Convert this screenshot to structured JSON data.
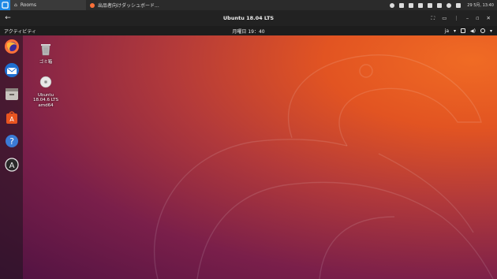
{
  "host": {
    "start_icon": "vmware-icon",
    "tabs": [
      {
        "label": "Rooms",
        "icon": "home-icon",
        "active": true
      },
      {
        "label": "出品者向けダッシュボード...",
        "icon": "firefox-icon",
        "active": false
      }
    ],
    "tray_icons": [
      "settings-icon",
      "bell-icon",
      "bluetooth-icon",
      "battery-icon",
      "volume-icon",
      "network-icon",
      "cloud-icon",
      "clipboard-icon"
    ],
    "clock": "29 5月, 13:40"
  },
  "vm": {
    "title": "Ubuntu 18.04 LTS",
    "controls": [
      "fullscreen-icon",
      "console-icon",
      "more-icon",
      "minimize-icon",
      "maximize-icon",
      "close-icon"
    ]
  },
  "panel": {
    "activities": "アクティビティ",
    "clock": "月曜日 19：40",
    "status": {
      "language": "ja"
    }
  },
  "dock": {
    "apps": [
      "firefox-icon",
      "thunderbird-icon",
      "files-icon",
      "software-center-icon",
      "help-icon",
      "software-updater-icon"
    ]
  },
  "desktop": {
    "icons": [
      {
        "label": "ゴミ箱",
        "icon": "trash-icon"
      },
      {
        "label": "Ubuntu 18.04.6 LTS amd64",
        "icon": "dvd-icon"
      }
    ]
  },
  "colors": {
    "accent": "#e95420",
    "panel": "#1d1d1d"
  }
}
